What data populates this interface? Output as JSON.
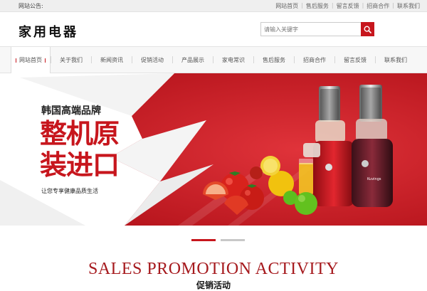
{
  "topbar": {
    "notice": "网站公告:",
    "links": [
      "网站首页",
      "售后服务",
      "留言反馈",
      "招商合作",
      "联系我们"
    ]
  },
  "header": {
    "logo": "家用电器",
    "search": {
      "placeholder": "请输入关键字",
      "button_icon": "search-icon"
    }
  },
  "nav": {
    "items": [
      {
        "label": "网站首页",
        "active": true
      },
      {
        "label": "关于我们"
      },
      {
        "label": "新闻资讯"
      },
      {
        "label": "促销活动"
      },
      {
        "label": "产品展示"
      },
      {
        "label": "家电常识"
      },
      {
        "label": "售后服务"
      },
      {
        "label": "招商合作"
      },
      {
        "label": "留言反馈"
      },
      {
        "label": "联系我们"
      }
    ]
  },
  "banner": {
    "brand": "韩国高端品牌",
    "headline_line1": "整机原",
    "headline_line2": "装进口",
    "slogan": "让您专享健康品质生活",
    "product_label": "Kuvings"
  },
  "slider": {
    "count": 2,
    "active_index": 0
  },
  "promo": {
    "title_en": "SALES PROMOTION ACTIVITY",
    "title_cn": "促销活动"
  },
  "colors": {
    "accent": "#c7161d",
    "promo_title": "#a61a1e",
    "dot_inactive": "#c8c8c8"
  }
}
